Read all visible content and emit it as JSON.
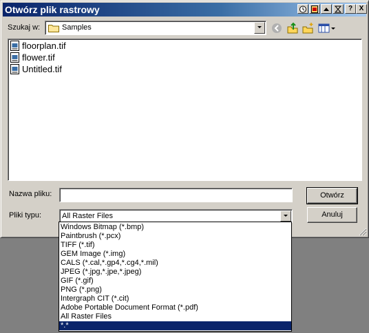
{
  "window": {
    "title": "Otwórz plik rastrowy"
  },
  "title_buttons": [
    {
      "icon": "clock-icon"
    },
    {
      "icon": "document-icon"
    },
    {
      "icon": "triangle-up-icon"
    },
    {
      "icon": "hourglass-icon"
    },
    {
      "icon": "help-icon",
      "glyph": "?"
    },
    {
      "icon": "close-icon",
      "glyph": "X"
    }
  ],
  "look_in": {
    "label": "Szukaj w:",
    "value": "Samples"
  },
  "toolbar": {
    "back_icon": "back-arrow-icon",
    "up_icon": "up-folder-icon",
    "new_folder_icon": "new-folder-icon",
    "view_icon": "view-menu-icon"
  },
  "files": [
    {
      "name": "floorplan.tif"
    },
    {
      "name": "flower.tif"
    },
    {
      "name": "Untitled.tif"
    }
  ],
  "filename": {
    "label": "Nazwa pliku:",
    "value": ""
  },
  "filetype": {
    "label": "Pliki typu:",
    "value": "All Raster Files",
    "options": [
      "Windows Bitmap (*.bmp)",
      "Paintbrush (*.pcx)",
      "TIFF (*.tif)",
      "GEM Image (*.img)",
      "CALS (*.cal,*.gp4,*.cg4,*.mil)",
      "JPEG (*.jpg,*.jpe,*.jpeg)",
      "GIF (*.gif)",
      "PNG (*.png)",
      "Intergraph CIT (*.cit)",
      "Adobe Portable Document Format (*.pdf)",
      "All Raster Files",
      "*.*"
    ],
    "selected_option": "*.*"
  },
  "buttons": {
    "open": "Otwórz",
    "cancel": "Anuluj"
  },
  "colors": {
    "title_start": "#0a246a",
    "title_end": "#a6caf0",
    "face": "#d4d0c8",
    "highlight": "#0a246a"
  }
}
